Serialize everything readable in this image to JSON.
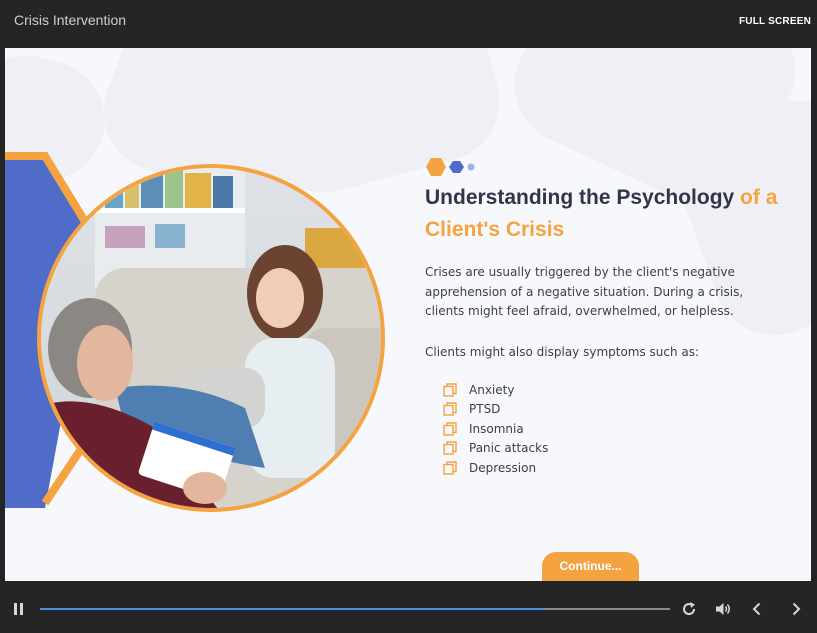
{
  "header": {
    "course_title": "Crisis Intervention",
    "fullscreen_label": "FULL SCREEN"
  },
  "slide": {
    "headline_main": "Understanding the Psychology ",
    "headline_accent": "of a Client's Crisis",
    "paragraph1": "Crises are usually triggered by the client's negative apprehension of a negative situation. During a crisis, clients might feel afraid, overwhelmed, or helpless.",
    "paragraph2": "Clients might also display symptoms such as:",
    "symptoms": [
      "Anxiety",
      "PTSD",
      "Insomnia",
      "Panic attacks",
      "Depression"
    ],
    "continue_label": "Continue...",
    "image_icon": "counseling-session-photo"
  },
  "player": {
    "progress": 0.8,
    "icons": {
      "pause": "pause-icon",
      "replay": "replay-icon",
      "volume": "volume-icon",
      "prev": "chevron-left-icon",
      "next": "chevron-right-icon"
    }
  },
  "colors": {
    "accent_orange": "#f4a340",
    "accent_blue": "#4f6cc9",
    "progress_blue": "#4e8fe0",
    "heading_dark": "#2f3647",
    "chrome_bg": "#252525"
  }
}
